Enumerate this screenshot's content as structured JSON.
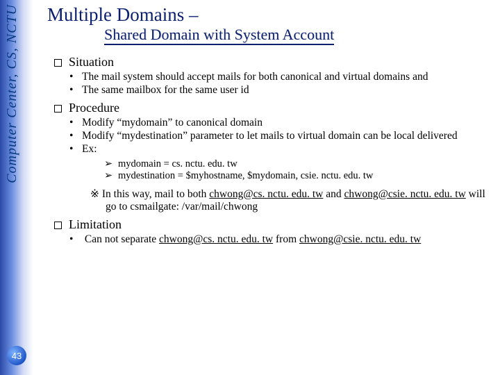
{
  "sidebar": {
    "label": "Computer Center, CS, NCTU",
    "page_number": "43"
  },
  "title": "Multiple Domains –",
  "subtitle": "Shared Domain with System Account",
  "sections": {
    "situation": {
      "heading": "Situation",
      "items": [
        "The mail system should accept mails for both canonical and virtual domains and",
        "The same mailbox for the same user id"
      ]
    },
    "procedure": {
      "heading": "Procedure",
      "items": [
        "Modify “mydomain” to canonical domain",
        "Modify “mydestination” parameter to let mails to virtual domain can be local delivered",
        "Ex:"
      ],
      "examples": [
        "mydomain = cs. nctu. edu. tw",
        "mydestination = $myhostname, $mydomain, csie. nctu. edu. tw"
      ]
    },
    "note": {
      "prefix": "※ In this way, mail to both ",
      "email1": "chwong@cs. nctu. edu. tw",
      "mid": " and ",
      "email2": "chwong@csie. nctu. edu. tw",
      "suffix": " will go to csmailgate: /var/mail/chwong"
    },
    "limitation": {
      "heading": "Limitation",
      "item_prefix": "Can not separate ",
      "email1": "chwong@cs. nctu. edu. tw",
      "mid": " from ",
      "email2": "chwong@csie. nctu. edu. tw"
    }
  }
}
